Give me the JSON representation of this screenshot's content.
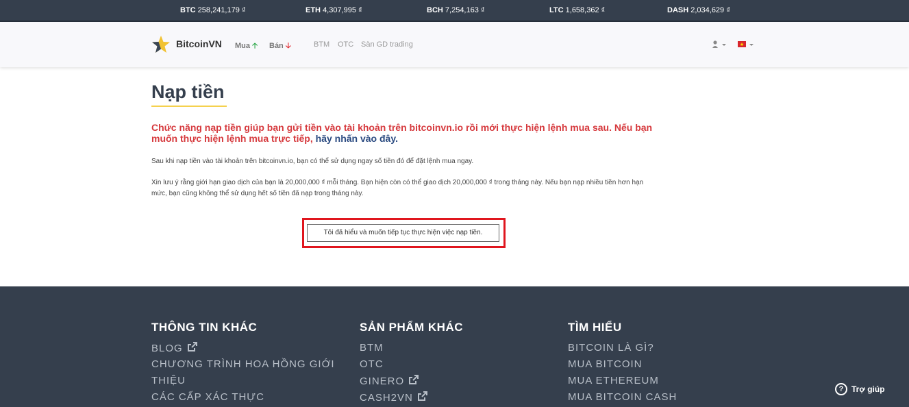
{
  "ticker": [
    {
      "symbol": "BTC",
      "price": "258,241,179 ₫"
    },
    {
      "symbol": "ETH",
      "price": "4,307,995 ₫"
    },
    {
      "symbol": "BCH",
      "price": "7,254,163 ₫"
    },
    {
      "symbol": "LTC",
      "price": "1,658,362 ₫"
    },
    {
      "symbol": "DASH",
      "price": "2,034,629 ₫"
    }
  ],
  "nav": {
    "brand": "BitcoinVN",
    "buy": "Mua",
    "sell": "Bán",
    "links": [
      "BTM",
      "OTC",
      "Sàn GD trading"
    ]
  },
  "main": {
    "title": "Nạp tiền",
    "intro_red": "Chức năng nạp tiền giúp bạn gửi tiền vào tài khoản trên bitcoinvn.io rồi mới thực hiện lệnh mua sau. Nếu bạn muốn thực hiện lệnh mua trực tiếp,",
    "intro_link": "hãy nhấn vào đây",
    "intro_tail": ".",
    "para1": "Sau khi nạp tiền vào tài khoản trên bitcoinvn.io, bạn có thể sử dụng ngay số tiền đó để đặt lệnh mua ngay.",
    "para2": "Xin lưu ý rằng giới hạn giao dịch của bạn là 20,000,000 ₫ mỗi tháng. Bạn hiện còn có thể giao dịch 20,000,000 ₫ trong tháng này. Nếu bạn nạp nhiều tiền hơn hạn mức, bạn cũng không thể sử dụng hết số tiền đã nạp trong tháng này.",
    "confirm_button": "Tôi đã hiểu và muốn tiếp tục thực hiện việc nạp tiền."
  },
  "footer": {
    "col1": {
      "title": "THÔNG TIN KHÁC",
      "blog": "BLOG",
      "commission_line1": "CHƯƠNG TRÌNH HOA HỒNG GIỚI",
      "commission_line2": "THIỆU",
      "verification": "CÁC CẤP XÁC THỰC"
    },
    "col2": {
      "title": "SẢN PHẨM KHÁC",
      "btm": "BTM",
      "otc": "OTC",
      "ginero": "GINERO",
      "cash2vn": "CASH2VN"
    },
    "col3": {
      "title": "TÌM HIỂU",
      "what_is_bitcoin": "BITCOIN LÀ GÌ?",
      "buy_bitcoin": "MUA BITCOIN",
      "buy_ethereum": "MUA ETHEREUM",
      "buy_bitcoin_cash": "MUA BITCOIN CASH"
    }
  },
  "help": {
    "label": "Trợ giúp"
  },
  "colors": {
    "dark": "#353f4d",
    "accent_red": "#d63a3e",
    "highlight_box": "#e0161e",
    "underline": "#f5d14e"
  }
}
